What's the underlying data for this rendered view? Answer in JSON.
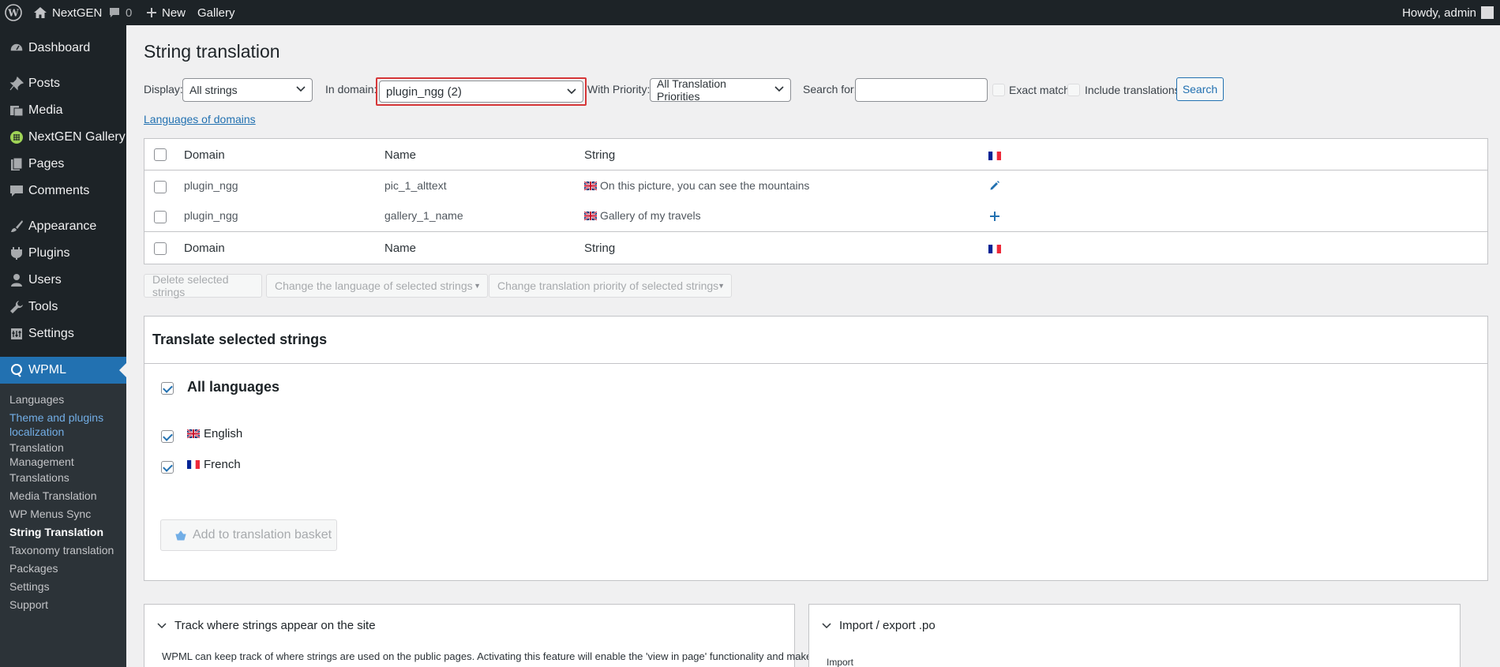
{
  "adminbar": {
    "site_name": "NextGEN",
    "comments_count": "0",
    "new_label": "New",
    "gallery_label": "Gallery",
    "howdy": "Howdy, admin"
  },
  "sidebar": {
    "items": [
      {
        "label": "Dashboard",
        "icon": "dashboard-icon"
      },
      {
        "label": "Posts",
        "icon": "pushpin-icon"
      },
      {
        "label": "Media",
        "icon": "media-icon"
      },
      {
        "label": "NextGEN Gallery",
        "icon": "nextgen-icon"
      },
      {
        "label": "Pages",
        "icon": "pages-icon"
      },
      {
        "label": "Comments",
        "icon": "comment-icon"
      },
      {
        "label": "Appearance",
        "icon": "brush-icon"
      },
      {
        "label": "Plugins",
        "icon": "plugin-icon"
      },
      {
        "label": "Users",
        "icon": "users-icon"
      },
      {
        "label": "Tools",
        "icon": "wrench-icon"
      },
      {
        "label": "Settings",
        "icon": "settings-icon"
      },
      {
        "label": "WPML",
        "icon": "wpml-icon"
      }
    ],
    "submenu": [
      {
        "label": "Languages"
      },
      {
        "label": "Theme and plugins localization"
      },
      {
        "label": "Translation Management"
      },
      {
        "label": "Translations"
      },
      {
        "label": "Media Translation"
      },
      {
        "label": "WP Menus Sync"
      },
      {
        "label": "String Translation"
      },
      {
        "label": "Taxonomy translation"
      },
      {
        "label": "Packages"
      },
      {
        "label": "Settings"
      },
      {
        "label": "Support"
      }
    ]
  },
  "page": {
    "title": "String translation",
    "filters": {
      "display_label": "Display:",
      "display_value": "All strings",
      "domain_label": "In domain:",
      "domain_value": "plugin_ngg (2)",
      "priority_label": "With Priority:",
      "priority_value": "All Translation Priorities",
      "search_label": "Search for:",
      "search_value": "",
      "exact_match_label": "Exact match",
      "include_translations_label": "Include translations",
      "search_button": "Search"
    },
    "languages_of_domains_link": "Languages of domains",
    "table": {
      "columns": [
        "Domain",
        "Name",
        "String"
      ],
      "rows": [
        {
          "domain": "plugin_ngg",
          "name": "pic_1_alttext",
          "string": "On this picture, you can see the mountains",
          "action": "edit-pencil-icon"
        },
        {
          "domain": "plugin_ngg",
          "name": "gallery_1_name",
          "string": "Gallery of my travels",
          "action": "add-plus-icon"
        }
      ]
    },
    "bulk": {
      "delete": "Delete selected strings",
      "change_language": "Change the language of selected strings",
      "change_priority": "Change translation priority of selected strings"
    },
    "translate_box": {
      "title": "Translate selected strings",
      "all_languages": "All languages",
      "languages": [
        {
          "label": "English",
          "flag": "uk-flag-icon"
        },
        {
          "label": "French",
          "flag": "france-flag-icon"
        }
      ],
      "basket_button": "Add to translation basket"
    },
    "track_panel": {
      "title": "Track where strings appear on the site",
      "text": "WPML can keep track of where strings are used on the public pages. Activating this feature will enable the 'view in page' functionality and make"
    },
    "import_panel": {
      "title": "Import / export .po",
      "text": "Import"
    }
  },
  "colors": {
    "admin_bg": "#1d2327",
    "accent": "#2271b1",
    "highlight_border": "#d63638"
  }
}
